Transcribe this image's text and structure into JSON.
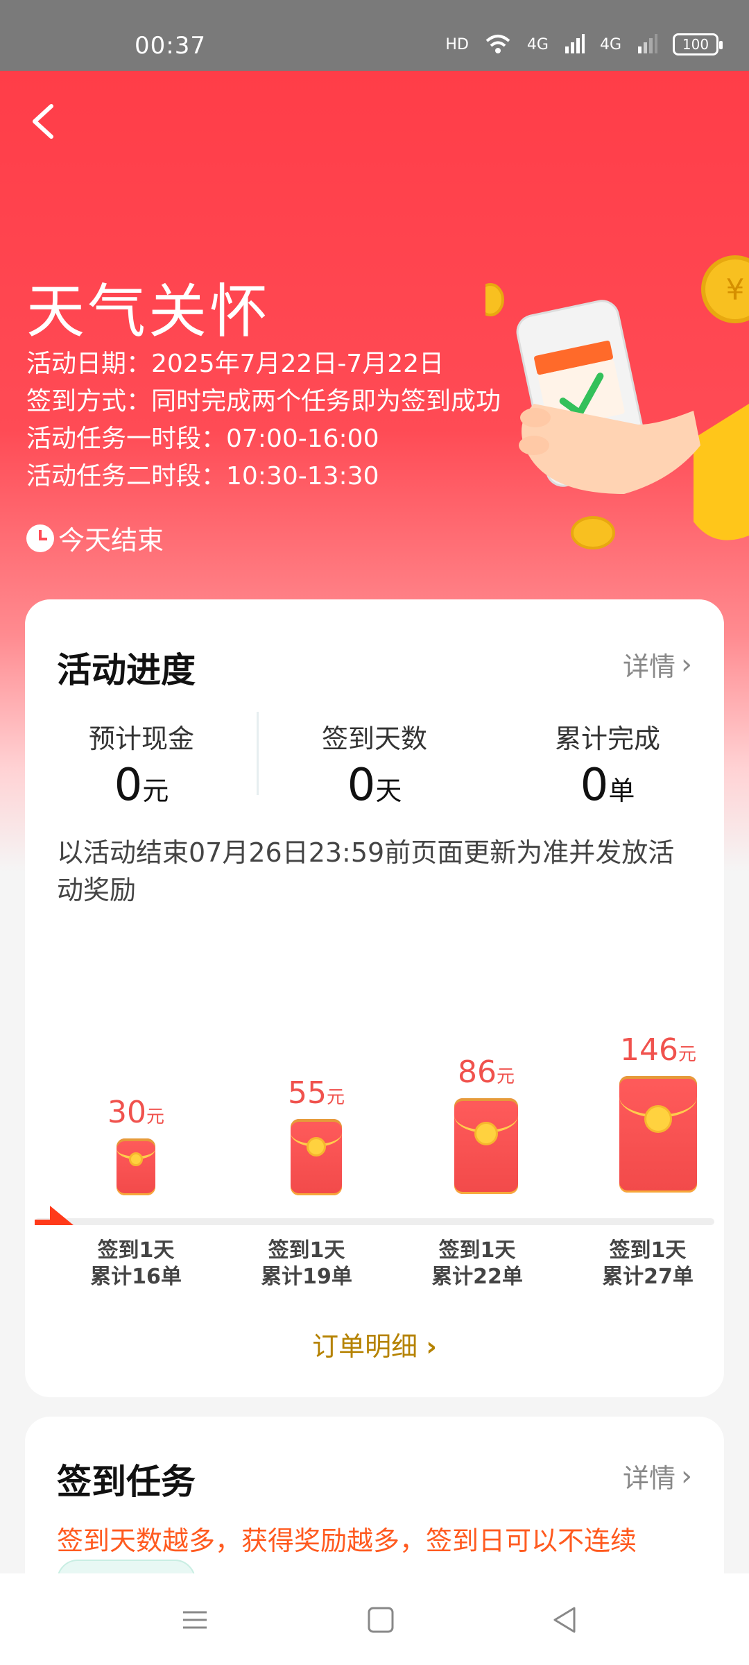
{
  "status_bar": {
    "time": "00:37",
    "hd": "HD",
    "net1": "4G",
    "net2": "4G",
    "battery": "100"
  },
  "header": {
    "title": "天气关怀",
    "lines": [
      "活动日期：2025年7月22日-7月22日",
      "签到方式：同时完成两个任务即为签到成功",
      "活动任务一时段：07:00-16:00",
      "活动任务二时段：10:30-13:30"
    ],
    "end_text": "今天结束"
  },
  "progress_card": {
    "title": "活动进度",
    "detail_label": "详情",
    "stats": [
      {
        "label": "预计现金",
        "value": "0",
        "unit": "元"
      },
      {
        "label": "签到天数",
        "value": "0",
        "unit": "天"
      },
      {
        "label": "累计完成",
        "value": "0",
        "unit": "单"
      }
    ],
    "note": "以活动结束07月26日23:59前页面更新为准并发放活动奖励",
    "milestones": [
      {
        "amount": "30",
        "unit": "元",
        "line1": "签到1天",
        "line2": "累计16单"
      },
      {
        "amount": "55",
        "unit": "元",
        "line1": "签到1天",
        "line2": "累计19单"
      },
      {
        "amount": "86",
        "unit": "元",
        "line1": "签到1天",
        "line2": "累计22单"
      },
      {
        "amount": "146",
        "unit": "元",
        "line1": "签到1天",
        "line2": "累计27单"
      }
    ],
    "order_link": "订单明细"
  },
  "task_card": {
    "title": "签到任务",
    "detail_label": "详情",
    "subtitle": "签到天数越多，获得奖励越多，签到日可以不连续"
  },
  "colors": {
    "accent": "#ff4b55",
    "gold": "#b58200",
    "orange": "#ff5a1f"
  }
}
